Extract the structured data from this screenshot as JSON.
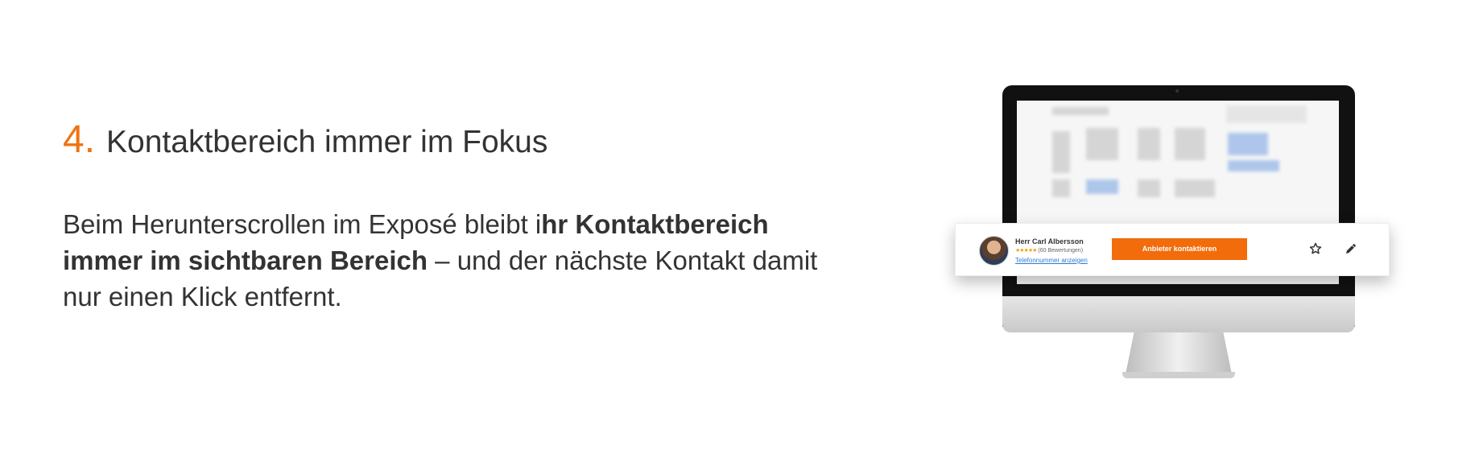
{
  "feature": {
    "number": "4.",
    "title": "Kontaktbereich immer im Fokus",
    "text_part1": "Beim Herunterscrollen im Exposé bleibt i",
    "text_bold": "hr Kontaktbereich immer im sichtbaren Bereich",
    "text_part2": " – und der nächste Kontakt damit nur einen Klick entfernt."
  },
  "contact_bar": {
    "provider_name": "Herr Carl Albersson",
    "stars": "★★★★★",
    "ratings_text": "(60 Bewertungen)",
    "rating_value": 5,
    "phone_link": "Telefonnummer anzeigen",
    "contact_button": "Anbieter kontaktieren",
    "favorite_icon": "star-outline-icon",
    "edit_icon": "pencil-icon"
  },
  "colors": {
    "accent": "#f07212",
    "button": "#f26c0b",
    "link": "#2e7bd4",
    "text": "#333333"
  }
}
